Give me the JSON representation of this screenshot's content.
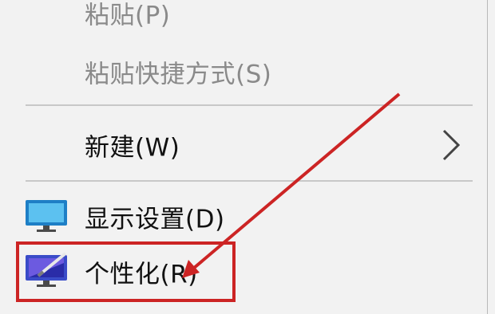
{
  "menu": {
    "paste_label": "粘贴(P)",
    "paste_shortcut_label": "粘贴快捷方式(S)",
    "new_label": "新建(W)",
    "display_settings_label": "显示设置(D)",
    "personalize_label": "个性化(R)"
  },
  "icons": {
    "submenu": "chevron-right-icon",
    "display_settings": "monitor-icon",
    "personalize": "personalize-monitor-icon"
  },
  "colors": {
    "annotation": "#cc2424",
    "menu_background": "#f2f2f2",
    "disabled_text": "#8a8a8a"
  }
}
